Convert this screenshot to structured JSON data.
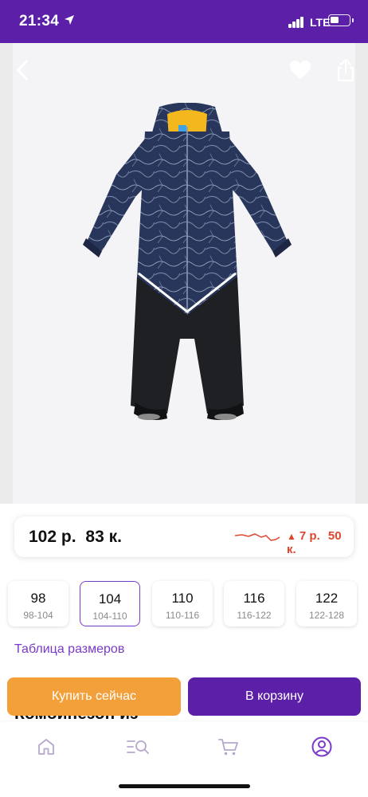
{
  "status_bar": {
    "time": "21:34",
    "network": "LTE"
  },
  "nav": {
    "back_icon": "chevron-left-icon",
    "favorite_icon": "heart-icon",
    "share_icon": "share-icon"
  },
  "price": {
    "rubles": "102 р.",
    "kopecks": "83 к.",
    "change_rubles": "7 р.",
    "change_kopecks": "50 к.",
    "change_color": "#e0452e"
  },
  "sizes": [
    {
      "size": "98",
      "range": "98-104",
      "selected": false
    },
    {
      "size": "104",
      "range": "104-110",
      "selected": true
    },
    {
      "size": "110",
      "range": "110-116",
      "selected": false
    },
    {
      "size": "116",
      "range": "116-122",
      "selected": false
    },
    {
      "size": "122",
      "range": "122-128",
      "selected": false
    }
  ],
  "size_table_link": "Таблица размеров",
  "partial_title": "Комбинезон из",
  "actions": {
    "buy_now": "Купить сейчас",
    "add_to_cart": "В корзину"
  },
  "colors": {
    "brand_purple": "#5b1fa8",
    "buy_orange": "#f4a03a",
    "accent_purple": "#7a3ac8"
  },
  "tab_bar": [
    "home-icon",
    "catalog-search-icon",
    "cart-icon",
    "profile-icon"
  ]
}
